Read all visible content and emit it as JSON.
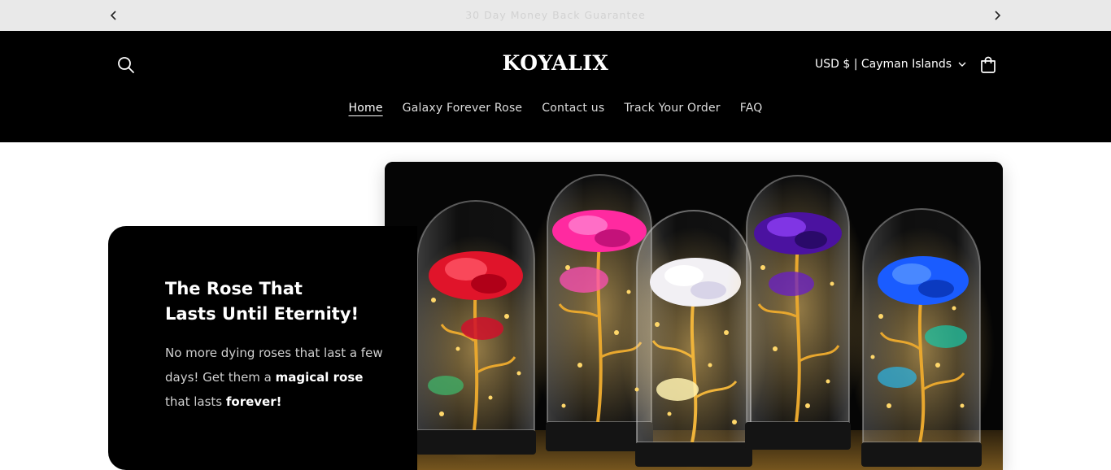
{
  "announcement": {
    "text": "30 Day Money Back Guarantee",
    "prev_icon": "chevron-left-icon",
    "next_icon": "chevron-right-icon"
  },
  "header": {
    "logo": "KOYALIX",
    "currency": "USD $ | Cayman Islands",
    "search_icon": "search-icon",
    "cart_icon": "cart-icon",
    "nav": [
      {
        "label": "Home",
        "active": true
      },
      {
        "label": "Galaxy Forever Rose",
        "active": false
      },
      {
        "label": "Contact us",
        "active": false
      },
      {
        "label": "Track Your Order",
        "active": false
      },
      {
        "label": "FAQ",
        "active": false
      }
    ]
  },
  "hero": {
    "title_line1": "The Rose That",
    "title_line2": "Lasts Until Eternity!",
    "body_part1": "No more dying roses that last a few days! Get them a ",
    "body_bold1": "magical rose",
    "body_part2": " that lasts ",
    "body_bold2": "forever!",
    "image_alt": "Five glowing galaxy roses in glass domes with fairy lights",
    "colors": {
      "card_bg": "#000000",
      "rose_red": "#e0142a",
      "rose_pink": "#ff2aa0",
      "rose_white": "#f2f0f4",
      "rose_purple": "#6a1ec8",
      "rose_blue": "#1a5cff",
      "gold_lights": "#ffc24a"
    }
  }
}
